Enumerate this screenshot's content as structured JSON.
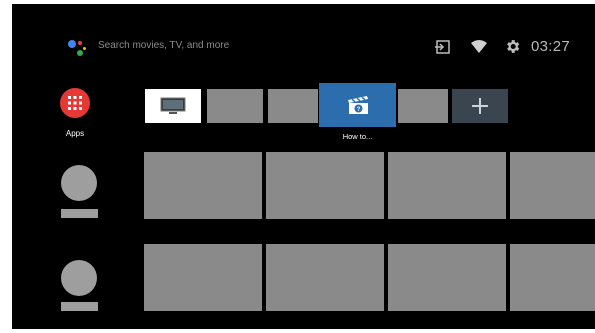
{
  "topbar": {
    "assistant_icon": "google-assistant-icon",
    "search_placeholder": "Search movies, TV, and more",
    "input_icon": "input-source-icon",
    "wifi_icon": "wifi-icon",
    "settings_icon": "gear-icon",
    "clock": "03:27"
  },
  "apps": {
    "icon": "apps-grid-icon",
    "label": "Apps",
    "color": "#e53935"
  },
  "channel_row": {
    "tiles": [
      {
        "icon": "tv-icon"
      },
      {
        "icon": "none"
      },
      {
        "icon": "none"
      },
      {
        "icon": "clapperboard-help-icon",
        "label": "How to...",
        "focused": true,
        "color": "#2c6dae"
      },
      {
        "icon": "none"
      },
      {
        "icon": "plus-icon"
      }
    ]
  },
  "program_rows": [
    {
      "channel_avatar": "channel-placeholder",
      "cards": 4
    },
    {
      "channel_avatar": "channel-placeholder",
      "cards": 4
    }
  ]
}
